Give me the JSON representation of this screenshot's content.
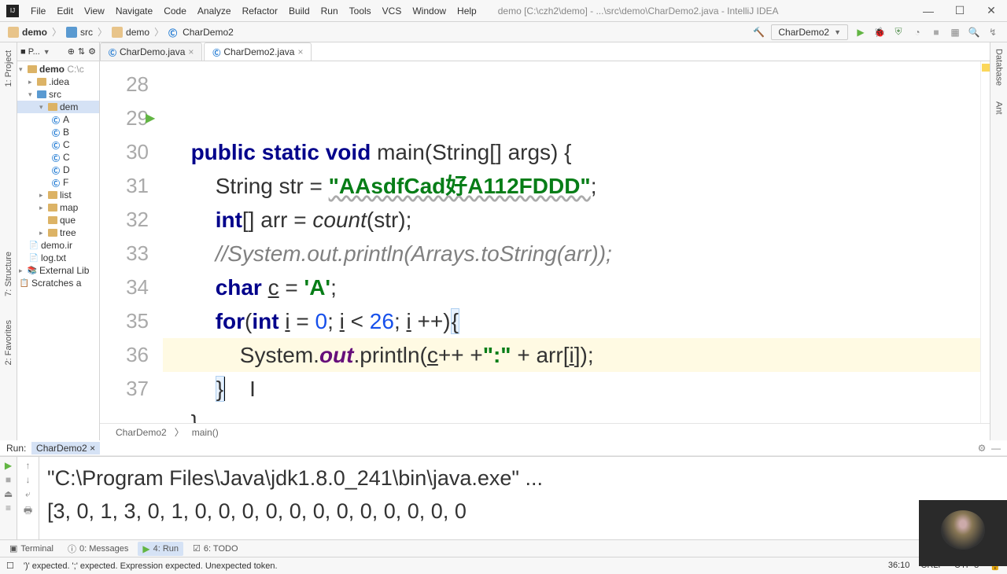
{
  "window": {
    "title_path": "demo [C:\\czh2\\demo] - ...\\src\\demo\\CharDemo2.java - IntelliJ IDEA"
  },
  "menu": [
    "File",
    "Edit",
    "View",
    "Navigate",
    "Code",
    "Analyze",
    "Refactor",
    "Build",
    "Run",
    "Tools",
    "VCS",
    "Window",
    "Help"
  ],
  "breadcrumbs": {
    "items": [
      "demo",
      "src",
      "demo",
      "CharDemo2"
    ]
  },
  "run_config": {
    "name": "CharDemo2"
  },
  "project_tree": {
    "root": "demo",
    "root_hint": "C:\\c",
    "idea": ".idea",
    "src": "src",
    "pkg": "dem",
    "clsA": "A",
    "clsB": "B",
    "clsC": "C",
    "clsC2": "C",
    "clsD": "D",
    "clsF": "F",
    "list": "list",
    "map": "map",
    "que": "que",
    "tree": "tree",
    "demoini": "demo.ir",
    "logtxt": "log.txt",
    "extlib": "External Lib",
    "scratches": "Scratches a"
  },
  "editor": {
    "tabs": [
      {
        "name": "CharDemo.java"
      },
      {
        "name": "CharDemo2.java"
      }
    ],
    "lines": {
      "l28": "28",
      "l29": "29",
      "l30": "30",
      "l31": "31",
      "l32": "32",
      "l33": "33",
      "l34": "34",
      "l35": "35",
      "l36": "36",
      "l37": "37"
    },
    "code": {
      "l29_kw1": "public",
      "l29_kw2": "static",
      "l29_kw3": "void",
      "l29_name": " main(String[] args) {",
      "l30_kw": "String ",
      "l30_var": "str = ",
      "l30_str": "\"AAsdfCad好A112FDDD\"",
      "l30_end": ";",
      "l31_kw": "int",
      "l31_rest": "[] arr = ",
      "l31_call": "count",
      "l31_end": "(str);",
      "l32": "//System.out.println(Arrays.toString(arr));",
      "l33_kw": "char ",
      "l33_var": "c",
      "l33_mid": " = ",
      "l33_str": "'A'",
      "l33_end": ";",
      "l34_kw1": "for",
      "l34_p1": "(",
      "l34_kw2": "int ",
      "l34_i1": "i",
      "l34_eq": " = ",
      "l34_n0": "0",
      "l34_sc1": "; ",
      "l34_i2": "i",
      "l34_lt": " < ",
      "l34_n26": "26",
      "l34_sc2": "; ",
      "l34_i3": "i",
      "l34_pp": " ++)",
      "l34_brace": "{",
      "l35_p1": "System.",
      "l35_out": "out",
      "l35_p2": ".println(",
      "l35_c": "c",
      "l35_pp": "++ +",
      "l35_colon": "\":\"",
      "l35_plus": " + arr[",
      "l35_i": "i",
      "l35_end": "]);",
      "l36": "}",
      "l37": "}"
    },
    "bottom_crumbs": [
      "CharDemo2",
      "main()"
    ]
  },
  "run_panel": {
    "title": "Run:",
    "config": "CharDemo2",
    "out_line1": "\"C:\\Program Files\\Java\\jdk1.8.0_241\\bin\\java.exe\" ...",
    "out_line2": "[3, 0, 1, 3, 0, 1, 0, 0, 0, 0, 0, 0, 0, 0, 0, 0, 0, 0"
  },
  "bottom_tabs": {
    "terminal": "Terminal",
    "messages": "0: Messages",
    "run": "4: Run",
    "todo": "6: TODO"
  },
  "status": {
    "msg": "')' expected. ';' expected. Expression expected. Unexpected token.",
    "pos": "36:10",
    "eol": "CRLF",
    "enc": "UTF-8"
  },
  "side_tools": {
    "project": "1: Project",
    "structure": "7: Structure",
    "favorites": "2: Favorites",
    "database": "Database",
    "ant": "Ant"
  }
}
